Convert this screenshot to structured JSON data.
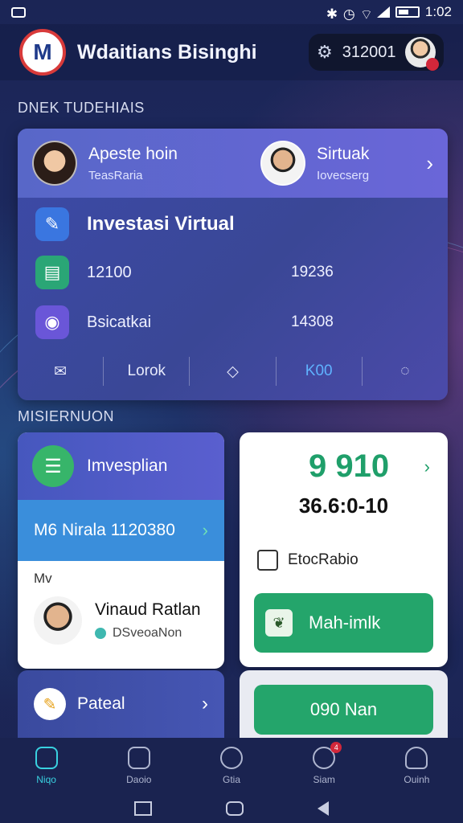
{
  "status_bar": {
    "time": "1:02"
  },
  "header": {
    "title": "Wdaitians Bisinghi",
    "pill_value": "312001",
    "logo_text": "M"
  },
  "section1_label": "DNEK TUDEHIAIS",
  "main_card": {
    "person_left": {
      "name": "Apeste hoin",
      "sub": "TeasRaria"
    },
    "person_right": {
      "name": "Sirtuak",
      "sub": "Iovecserg"
    },
    "title": "Investasi Virtual",
    "rows": [
      {
        "label": "12100",
        "value": "19236"
      },
      {
        "label": "Bsicatkai",
        "value": "14308"
      }
    ],
    "toolbar": {
      "item2": "Lorok",
      "item4": "K00"
    }
  },
  "section2_label": "MISIERNUON",
  "left_card": {
    "title": "Imvesplian",
    "band": "M6 Nirala 1120380",
    "small": "Mv",
    "person": {
      "name": "Vinaud Ratlan",
      "sub": "DSveoaNon"
    }
  },
  "left_card2": {
    "label": "Pateal"
  },
  "right_card": {
    "big": "9 910",
    "sub": "36.6:0-10",
    "doc": "EtocRabio",
    "button1": "Mah-imlk",
    "button2": "090 Nan"
  },
  "bottom_nav": {
    "items": [
      {
        "label": "Niqo"
      },
      {
        "label": "Daoio"
      },
      {
        "label": "Gtia"
      },
      {
        "label": "Siam"
      },
      {
        "label": "Ouinh"
      }
    ],
    "badge": "4"
  }
}
